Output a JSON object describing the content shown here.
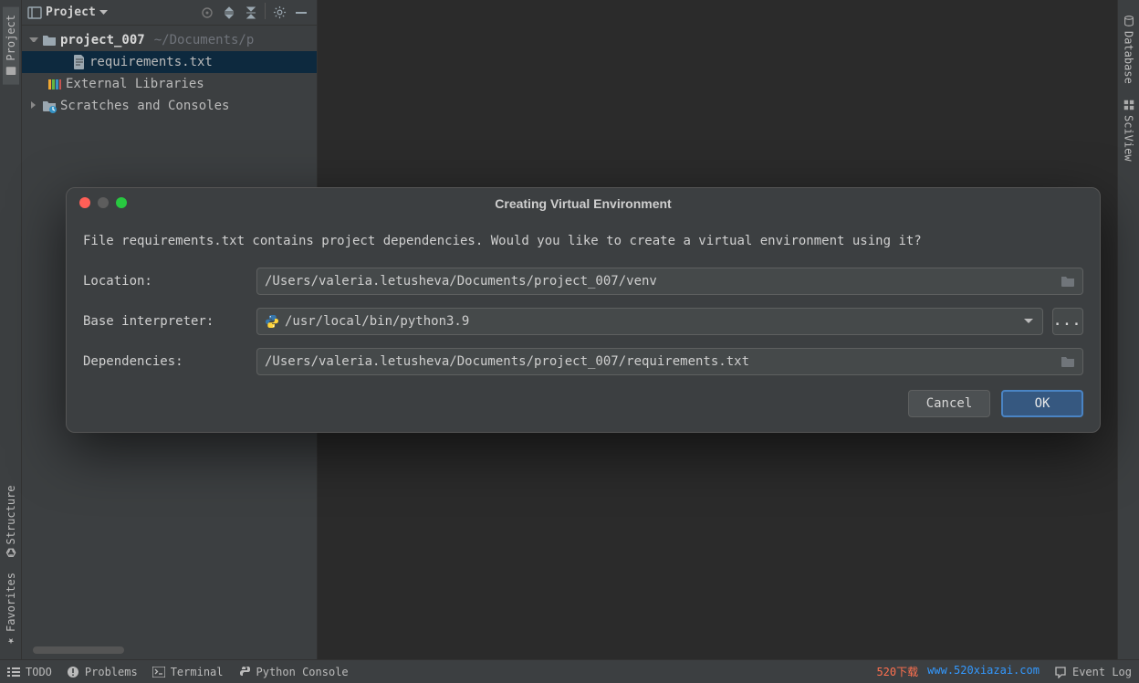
{
  "leftRail": {
    "project": "Project",
    "structure": "Structure",
    "favorites": "Favorites"
  },
  "rightRail": {
    "database": "Database",
    "sciview": "SciView"
  },
  "projectPanel": {
    "title": "Project",
    "tree": {
      "rootName": "project_007",
      "rootPath": "~/Documents/p",
      "file": "requirements.txt",
      "external": "External Libraries",
      "scratches": "Scratches and Consoles"
    }
  },
  "dialog": {
    "title": "Creating Virtual Environment",
    "message": "File requirements.txt contains project dependencies. Would you like to create a virtual environment using it?",
    "locationLabel": "Location:",
    "locationValue": "/Users/valeria.letusheva/Documents/project_007/venv",
    "interpreterLabel": "Base interpreter:",
    "interpreterValue": "/usr/local/bin/python3.9",
    "dependenciesLabel": "Dependencies:",
    "dependenciesValue": "/Users/valeria.letusheva/Documents/project_007/requirements.txt",
    "moreLabel": "...",
    "cancel": "Cancel",
    "ok": "OK"
  },
  "statusBar": {
    "todo": "TODO",
    "problems": "Problems",
    "terminal": "Terminal",
    "pythonConsole": "Python Console",
    "watermark1": "520下载",
    "watermark2": "www.520xiazai.com",
    "eventLog": "Event Log"
  }
}
